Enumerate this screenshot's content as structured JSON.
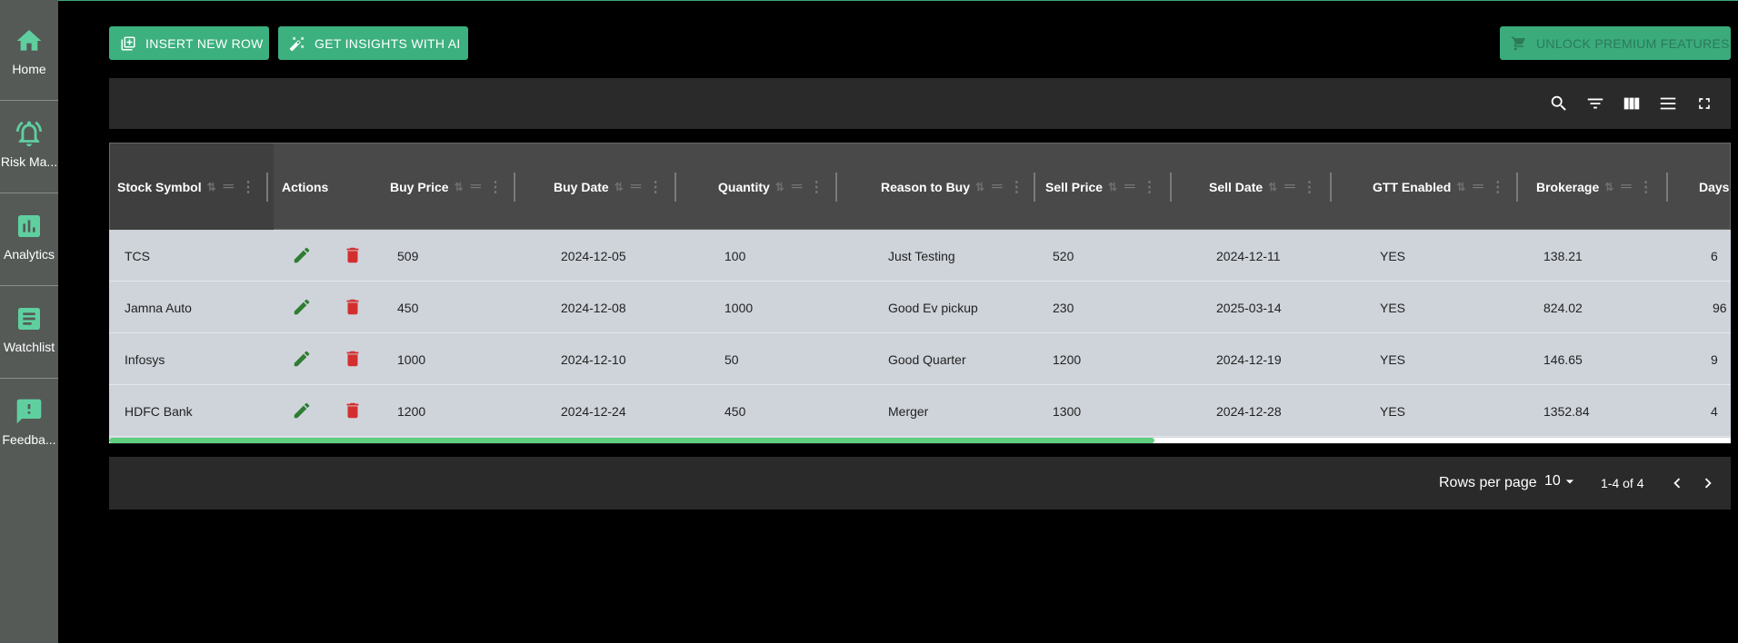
{
  "sidebar": {
    "items": [
      {
        "label": "Home",
        "icon": "home-icon"
      },
      {
        "label": "Risk Ma...",
        "icon": "bell-alert-icon"
      },
      {
        "label": "Analytics",
        "icon": "bar-chart-icon"
      },
      {
        "label": "Watchlist",
        "icon": "list-document-icon"
      },
      {
        "label": "Feedba...",
        "icon": "feedback-icon"
      }
    ]
  },
  "actions": {
    "insert_label": "INSERT NEW ROW",
    "insights_label": "GET INSIGHTS WITH AI",
    "premium_label": "UNLOCK PREMIUM FEATURES"
  },
  "toolbar": {
    "icons": [
      "search-icon",
      "filter-icon",
      "columns-icon",
      "density-icon",
      "fullscreen-icon"
    ]
  },
  "table": {
    "headers": {
      "symbol": "Stock Symbol",
      "actions": "Actions",
      "buy_price": "Buy Price",
      "buy_date": "Buy Date",
      "quantity": "Quantity",
      "reason": "Reason to Buy",
      "sell_price": "Sell Price",
      "sell_date": "Sell Date",
      "gtt": "GTT Enabled",
      "brokerage": "Brokerage",
      "days": "Days"
    },
    "rows": [
      {
        "symbol": "TCS",
        "buy_price": "509",
        "buy_date": "2024-12-05",
        "quantity": "100",
        "reason": "Just Testing",
        "sell_price": "520",
        "sell_date": "2024-12-11",
        "gtt": "YES",
        "brokerage": "138.21",
        "days": "6"
      },
      {
        "symbol": "Jamna Auto",
        "buy_price": "450",
        "buy_date": "2024-12-08",
        "quantity": "1000",
        "reason": "Good Ev pickup",
        "sell_price": "230",
        "sell_date": "2025-03-14",
        "gtt": "YES",
        "brokerage": "824.02",
        "days": "96"
      },
      {
        "symbol": "Infosys",
        "buy_price": "1000",
        "buy_date": "2024-12-10",
        "quantity": "50",
        "reason": "Good Quarter",
        "sell_price": "1200",
        "sell_date": "2024-12-19",
        "gtt": "YES",
        "brokerage": "146.65",
        "days": "9"
      },
      {
        "symbol": "HDFC Bank",
        "buy_price": "1200",
        "buy_date": "2024-12-24",
        "quantity": "450",
        "reason": "Merger",
        "sell_price": "1300",
        "sell_date": "2024-12-28",
        "gtt": "YES",
        "brokerage": "1352.84",
        "days": "4"
      }
    ]
  },
  "pagination": {
    "rows_per_page_label": "Rows per page",
    "rows_per_page_value": "10",
    "range": "1-4 of 4"
  },
  "colors": {
    "accent": "#3cb07f",
    "edit": "#2e7d32",
    "delete": "#d32f2f",
    "row_bg": "#cfd4db"
  }
}
